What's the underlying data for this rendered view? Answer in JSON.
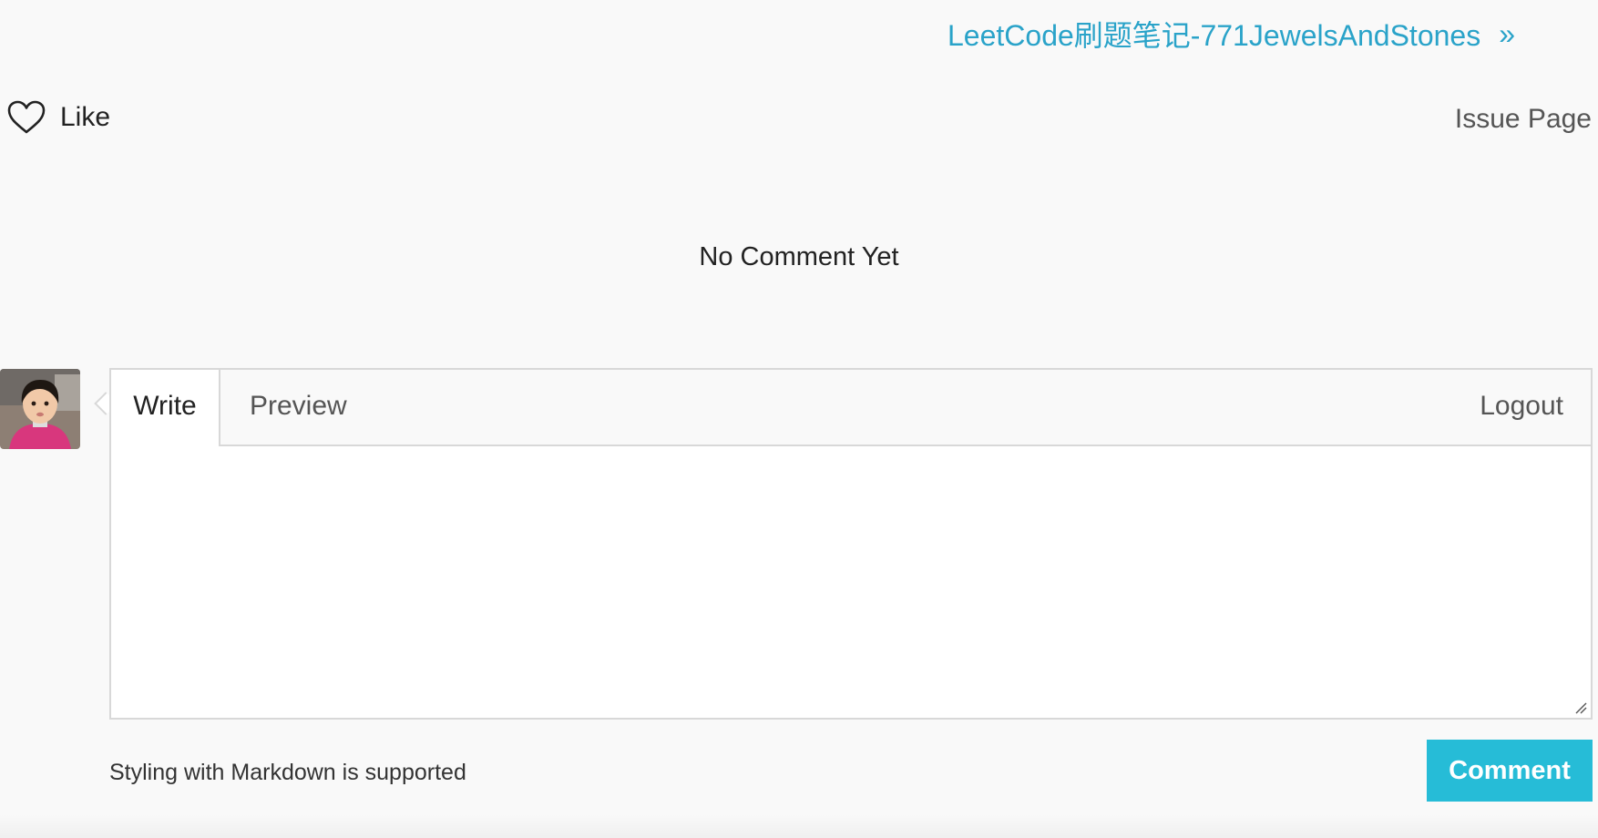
{
  "nav": {
    "next_post_title": "LeetCode刷题笔记-771JewelsAndStones",
    "next_icon": "double-chevron-right-icon"
  },
  "reactions": {
    "like_label": "Like",
    "like_icon": "heart-outline-icon"
  },
  "issue_page_label": "Issue Page",
  "comments": {
    "empty_text": "No Comment Yet"
  },
  "editor": {
    "tabs": [
      {
        "label": "Write",
        "active": true
      },
      {
        "label": "Preview",
        "active": false
      }
    ],
    "logout_label": "Logout",
    "textarea_value": "",
    "markdown_tip": "Styling with Markdown is supported",
    "submit_label": "Comment"
  },
  "colors": {
    "link": "#2aa3c9",
    "button": "#26bcd7",
    "background": "#f9f9f9",
    "border": "#d8d8d8"
  }
}
